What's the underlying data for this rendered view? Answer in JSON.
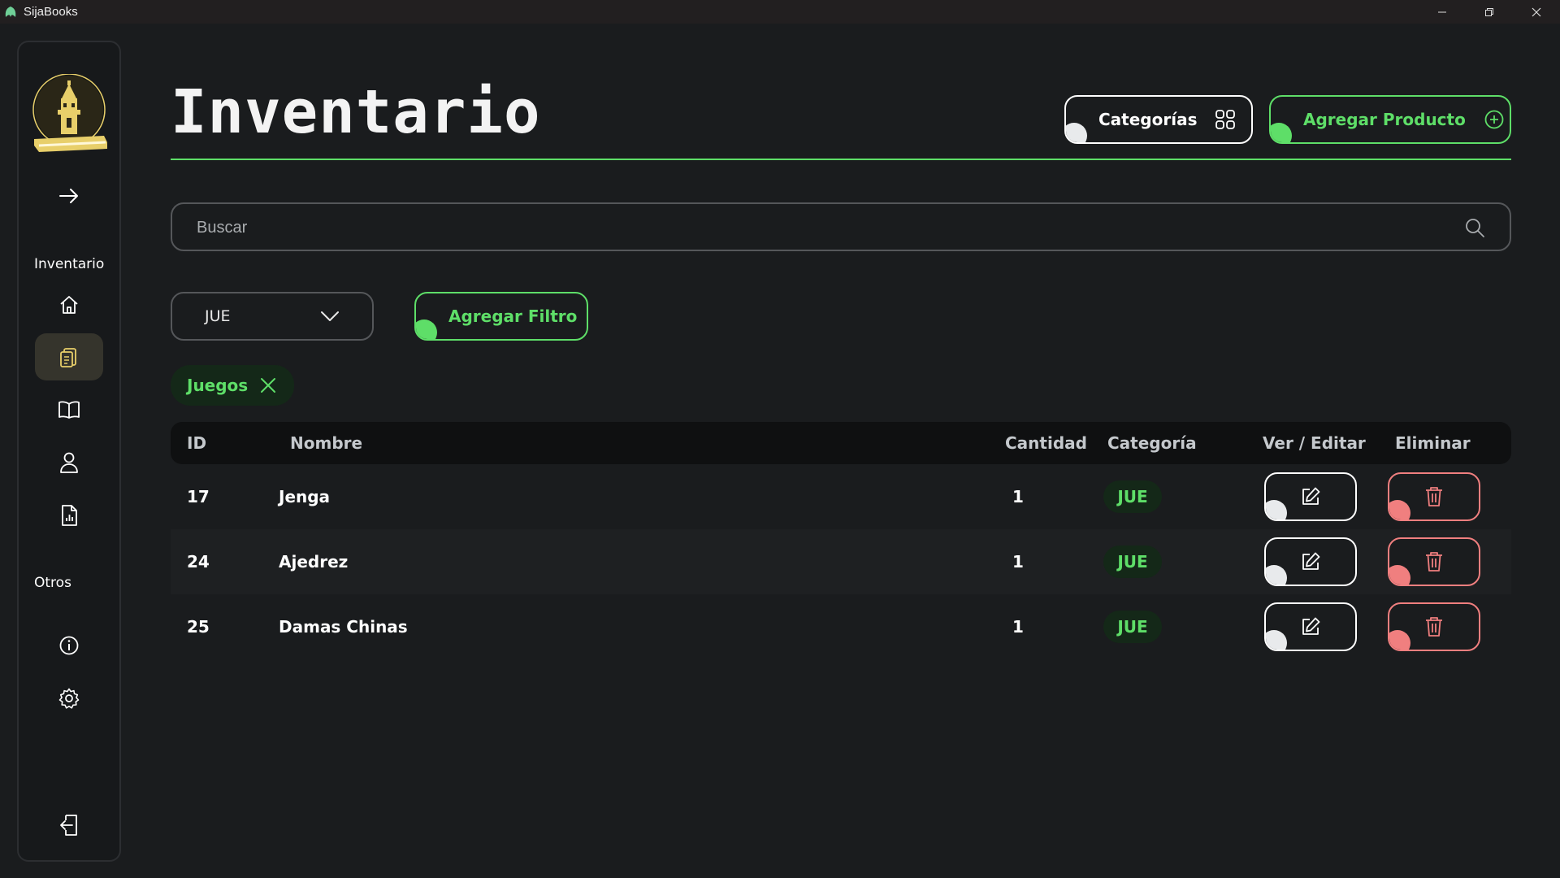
{
  "window": {
    "title": "SijaBooks",
    "icon": "leaf-app-icon",
    "controls": [
      "minimize-icon",
      "restore-icon",
      "close-icon"
    ]
  },
  "sidebar": {
    "toggle_icon": "arrow-right-icon",
    "sections": [
      {
        "label": "Inventario",
        "items": [
          {
            "name": "home",
            "icon": "home-icon",
            "active": false
          },
          {
            "name": "inventory",
            "icon": "clipboard-icon",
            "active": true
          },
          {
            "name": "books",
            "icon": "book-icon",
            "active": false
          },
          {
            "name": "users",
            "icon": "user-icon",
            "active": false
          },
          {
            "name": "reports",
            "icon": "report-icon",
            "active": false
          }
        ]
      },
      {
        "label": "Otros",
        "items": [
          {
            "name": "info",
            "icon": "info-icon",
            "active": false
          },
          {
            "name": "settings",
            "icon": "gear-icon",
            "active": false
          }
        ]
      }
    ],
    "logout_icon": "logout-icon"
  },
  "header": {
    "title": "Inventario",
    "categories_label": "Categorías",
    "add_product_label": "Agregar Producto"
  },
  "search": {
    "placeholder": "Buscar",
    "value": ""
  },
  "filter": {
    "selected": "JUE",
    "add_filter_label": "Agregar Filtro",
    "active_chips": [
      {
        "label": "Juegos"
      }
    ]
  },
  "table": {
    "columns": [
      "ID",
      "Nombre",
      "Cantidad",
      "Categoría",
      "Ver / Editar",
      "Eliminar"
    ],
    "rows": [
      {
        "id": "17",
        "nombre": "Jenga",
        "cantidad": "1",
        "categoria": "JUE"
      },
      {
        "id": "24",
        "nombre": "Ajedrez",
        "cantidad": "1",
        "categoria": "JUE"
      },
      {
        "id": "25",
        "nombre": "Damas Chinas",
        "cantidad": "1",
        "categoria": "JUE"
      }
    ]
  },
  "colors": {
    "accent_green": "#5ede68",
    "danger_red": "#f07f7f",
    "background": "#1a1c1e",
    "logo_gold": "#e8cf6a"
  }
}
